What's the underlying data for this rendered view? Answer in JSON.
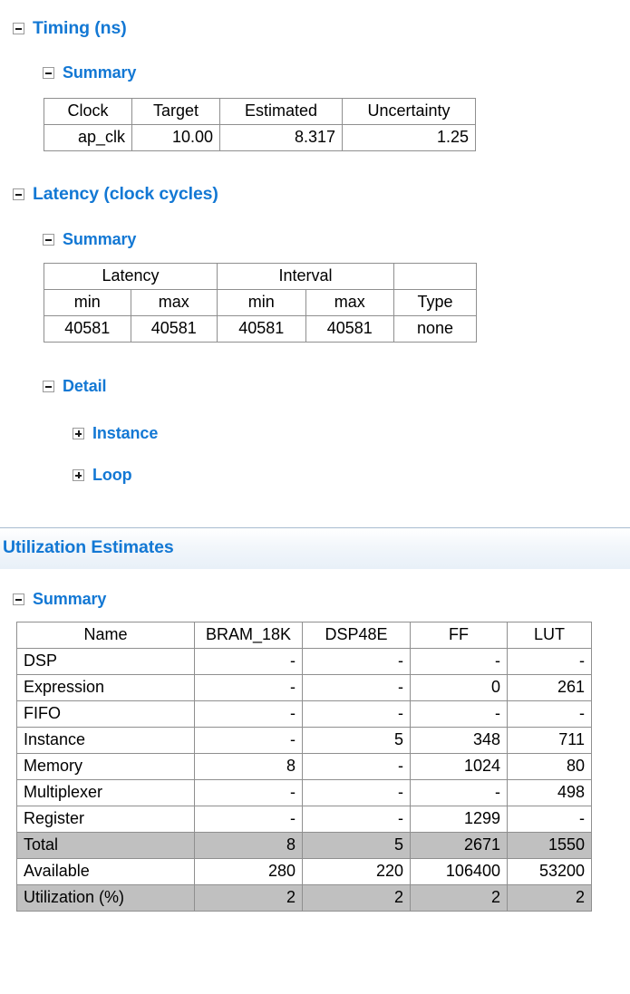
{
  "theme": {
    "heading_blue": "#1378d4",
    "table_border": "#8f8f8f",
    "shaded_row_bg": "#c0c0c0",
    "banner_rule": "#a8bcd0"
  },
  "sections": {
    "timing": {
      "title": "Timing (ns)",
      "expander": "minus-icon",
      "summary": {
        "title": "Summary",
        "expander": "minus-icon",
        "table": {
          "headers": [
            "Clock",
            "Target",
            "Estimated",
            "Uncertainty"
          ],
          "rows": [
            [
              "ap_clk",
              "10.00",
              "8.317",
              "1.25"
            ]
          ]
        }
      }
    },
    "latency": {
      "title": "Latency (clock cycles)",
      "expander": "minus-icon",
      "summary": {
        "title": "Summary",
        "expander": "minus-icon",
        "table": {
          "group_headers": [
            "Latency",
            "Interval",
            ""
          ],
          "sub_headers": [
            "min",
            "max",
            "min",
            "max",
            "Type"
          ],
          "rows": [
            [
              "40581",
              "40581",
              "40581",
              "40581",
              "none"
            ]
          ]
        }
      },
      "detail": {
        "title": "Detail",
        "expander": "minus-icon",
        "children": [
          {
            "title": "Instance",
            "expander": "plus-icon"
          },
          {
            "title": "Loop",
            "expander": "plus-icon"
          }
        ]
      }
    },
    "utilization": {
      "title": "Utilization Estimates",
      "summary": {
        "title": "Summary",
        "expander": "minus-icon",
        "table": {
          "headers": [
            "Name",
            "BRAM_18K",
            "DSP48E",
            "FF",
            "LUT"
          ],
          "rows": [
            {
              "name": "DSP",
              "bram": "-",
              "dsp": "-",
              "ff": "-",
              "lut": "-",
              "shaded": false
            },
            {
              "name": "Expression",
              "bram": "-",
              "dsp": "-",
              "ff": "0",
              "lut": "261",
              "shaded": false
            },
            {
              "name": "FIFO",
              "bram": "-",
              "dsp": "-",
              "ff": "-",
              "lut": "-",
              "shaded": false
            },
            {
              "name": "Instance",
              "bram": "-",
              "dsp": "5",
              "ff": "348",
              "lut": "711",
              "shaded": false
            },
            {
              "name": "Memory",
              "bram": "8",
              "dsp": "-",
              "ff": "1024",
              "lut": "80",
              "shaded": false
            },
            {
              "name": "Multiplexer",
              "bram": "-",
              "dsp": "-",
              "ff": "-",
              "lut": "498",
              "shaded": false
            },
            {
              "name": "Register",
              "bram": "-",
              "dsp": "-",
              "ff": "1299",
              "lut": "-",
              "shaded": false
            },
            {
              "name": "Total",
              "bram": "8",
              "dsp": "5",
              "ff": "2671",
              "lut": "1550",
              "shaded": true
            },
            {
              "name": "Available",
              "bram": "280",
              "dsp": "220",
              "ff": "106400",
              "lut": "53200",
              "shaded": false
            },
            {
              "name": "Utilization (%)",
              "bram": "2",
              "dsp": "2",
              "ff": "2",
              "lut": "2",
              "shaded": true
            }
          ]
        }
      }
    }
  }
}
